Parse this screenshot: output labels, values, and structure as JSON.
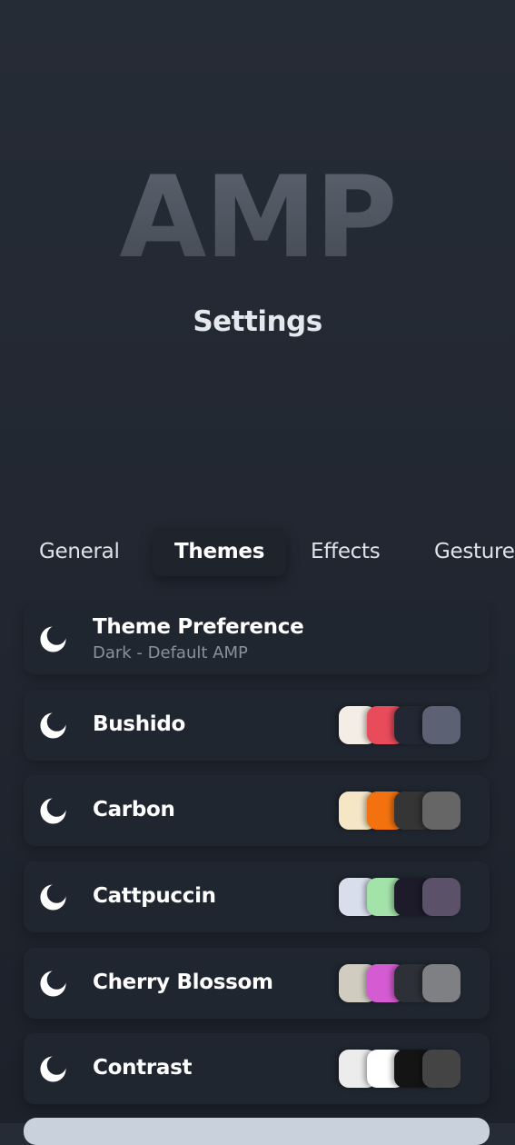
{
  "header": {
    "logo": "AMP",
    "subtitle": "Settings"
  },
  "tabs": [
    {
      "label": "General",
      "active": false
    },
    {
      "label": "Themes",
      "active": true
    },
    {
      "label": "Effects",
      "active": false
    },
    {
      "label": "Gesture",
      "active": false
    }
  ],
  "theme_preference": {
    "title": "Theme Preference",
    "value": "Dark - Default AMP",
    "icon": "moon-icon"
  },
  "themes": [
    {
      "name": "Bushido",
      "icon": "moon-icon",
      "swatches": [
        "#f4ede6",
        "#e84b5a",
        "#232733",
        "#5c6274"
      ]
    },
    {
      "name": "Carbon",
      "icon": "moon-icon",
      "swatches": [
        "#f5e6c6",
        "#f3720f",
        "#353535",
        "#666666"
      ]
    },
    {
      "name": "Cattpuccin",
      "icon": "moon-icon",
      "swatches": [
        "#d8deec",
        "#a3e3aa",
        "#1d1b2a",
        "#5b526a"
      ]
    },
    {
      "name": "Cherry Blossom",
      "icon": "moon-icon",
      "swatches": [
        "#d0ccc0",
        "#d55bd2",
        "#2e3038",
        "#7e8084"
      ]
    },
    {
      "name": "Contrast",
      "icon": "moon-icon",
      "swatches": [
        "#ececec",
        "#ffffff",
        "#141414",
        "#444444"
      ]
    }
  ],
  "colors": {
    "background": "#242a34",
    "card": "#202630",
    "active_tab": "#1e232c",
    "logo": "#4f5560"
  }
}
